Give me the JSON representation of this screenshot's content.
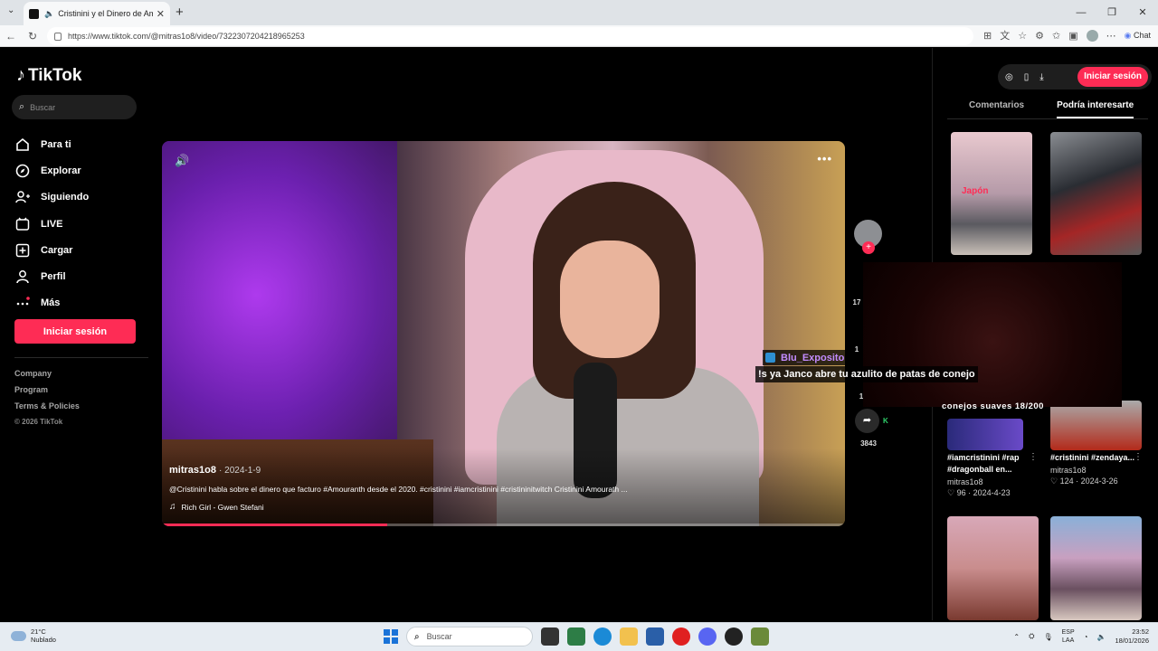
{
  "browser": {
    "tab_title": "Cristinini y el Dinero de Amou",
    "url": "https://www.tiktok.com/@mitras1o8/video/7322307204218965253",
    "chat_label": "Chat"
  },
  "sidebar": {
    "logo": "TikTok",
    "search_placeholder": "Buscar",
    "nav": [
      {
        "label": "Para ti",
        "icon": "home-icon"
      },
      {
        "label": "Explorar",
        "icon": "compass-icon"
      },
      {
        "label": "Siguiendo",
        "icon": "user-follow-icon"
      },
      {
        "label": "LIVE",
        "icon": "live-icon"
      },
      {
        "label": "Cargar",
        "icon": "upload-icon"
      },
      {
        "label": "Perfil",
        "icon": "profile-icon"
      },
      {
        "label": "Más",
        "icon": "more-dots-icon"
      }
    ],
    "login_button": "Iniciar sesión",
    "footer": {
      "company": "Company",
      "program": "Program",
      "terms": "Terms & Policies",
      "copyright": "© 2026 TikTok"
    }
  },
  "video": {
    "author": "mitras1o8",
    "date": "2024-1-9",
    "description": "@Cristinini habla sobre el dinero que facturo #Amouranth desde el 2020. #cristinini #iamcristinini #cristininitwitch Cristinini Amourath ...",
    "music": "Rich Girl - Gwen Stefani",
    "progress_fraction": 0.33,
    "overlay_user": "Blu_Exposito",
    "overlay_message": "!s ya Janco abre tu azulito de patas de conejo",
    "overlay_counter": "conejos suaves 18/200"
  },
  "actions": {
    "likes_partial": "17",
    "comments_partial": "1",
    "saves": "1",
    "shares": "3843"
  },
  "right_panel": {
    "login_button": "Iniciar sesión",
    "tabs": [
      "Comentarios",
      "Podría interesarte"
    ],
    "thumb1_tag": "Japón",
    "cards": [
      {
        "title": "#iamcristinini #rap #dragonball en...",
        "user": "mitras1o8",
        "likes": "96",
        "date": "2024-4-23"
      },
      {
        "title": "#cristinini #zendaya...",
        "user": "mitras1o8",
        "likes": "124",
        "date": "2024-3-26"
      }
    ]
  },
  "taskbar": {
    "temperature": "21°C",
    "weather": "Nublado",
    "search_placeholder": "Buscar",
    "lang_top": "ESP",
    "lang_bottom": "LAA",
    "time": "23:52",
    "date": "18/01/2026"
  }
}
